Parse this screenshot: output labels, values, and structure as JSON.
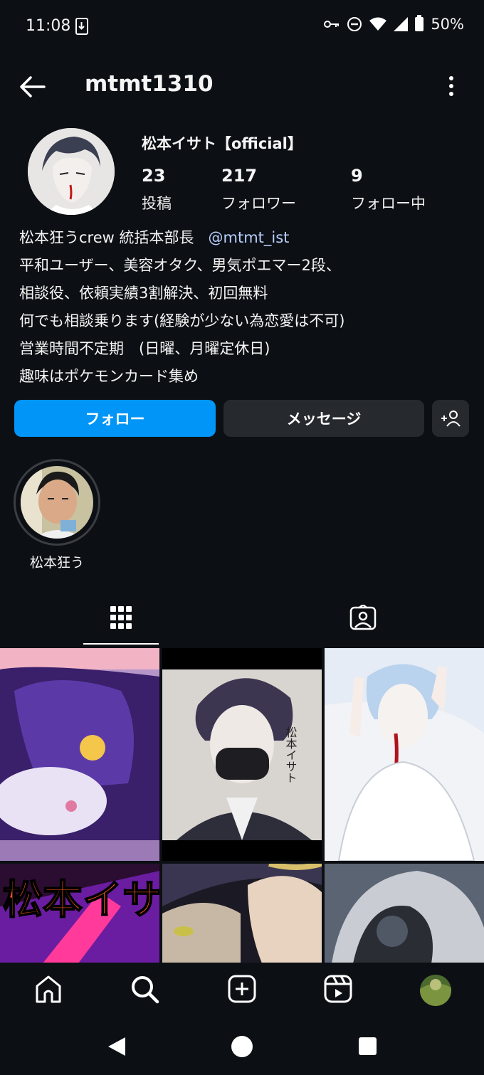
{
  "status_bar": {
    "time": "11:08",
    "battery": "50%"
  },
  "header": {
    "username": "mtmt1310"
  },
  "profile": {
    "display_name": "松本イサト【official】",
    "stats": [
      {
        "count": "23",
        "label": "投稿"
      },
      {
        "count": "217",
        "label": "フォロワー"
      },
      {
        "count": "9",
        "label": "フォロー中"
      }
    ],
    "bio_first": "松本狂うcrew 統括本部長",
    "bio_mention": "@mtmt_ist",
    "bio_lines": [
      "平和ユーザー、美容オタク、男気ポエマー2段、",
      "相談役、依頼実績3割解決、初回無料",
      "何でも相談乗ります(経験が少ない為恋愛は不可)",
      "営業時間不定期　(日曜、月曜定休日)",
      "趣味はポケモンカード集め"
    ]
  },
  "actions": {
    "follow": "フォロー",
    "message": "メッセージ",
    "add_user_icon": "add-person-icon"
  },
  "highlights": [
    {
      "label": "松本狂う"
    }
  ],
  "tabs": [
    {
      "name": "posts-grid",
      "icon": "grid-icon",
      "active": true
    },
    {
      "name": "tagged",
      "icon": "tagged-person-icon",
      "active": false
    }
  ],
  "nav": [
    "home-icon",
    "search-icon",
    "create-icon",
    "reels-icon",
    "profile-avatar"
  ],
  "colors": {
    "background": "#0c1014",
    "follow_button": "#0095f6",
    "secondary_button": "#262a2f",
    "mention": "#b9cfff"
  }
}
